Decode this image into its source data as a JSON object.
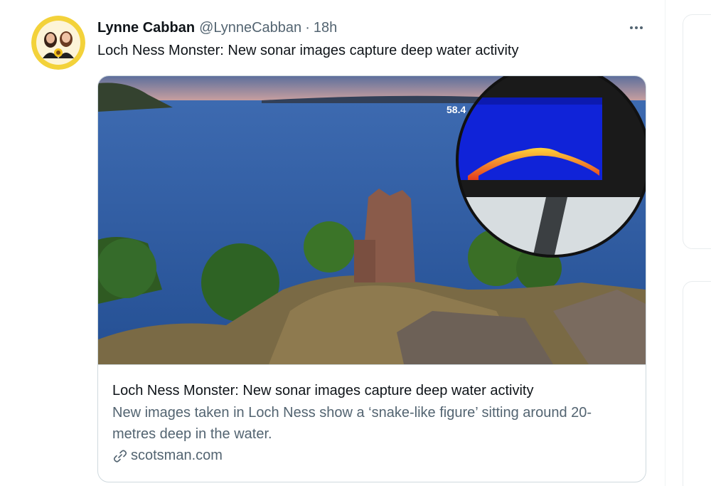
{
  "tweet": {
    "author_name": "Lynne Cabban",
    "author_handle": "@LynneCabban",
    "separator": "·",
    "timestamp": "18h",
    "text": "Loch Ness Monster: New sonar images capture deep water activity"
  },
  "card": {
    "title": "Loch Ness Monster: New sonar images capture deep water activity",
    "description": "New images taken in Loch Ness show a ‘snake-like figure’ sitting around 20-metres deep in the water.",
    "domain": "scotsman.com",
    "sonar_depth_reading": "58.4"
  },
  "icons": {
    "more": "more-horizontal-icon",
    "link": "link-icon"
  },
  "colors": {
    "text_primary": "#0f1419",
    "text_secondary": "#536471",
    "border": "#cfd9de",
    "sonar_screen": "#1023d8"
  }
}
